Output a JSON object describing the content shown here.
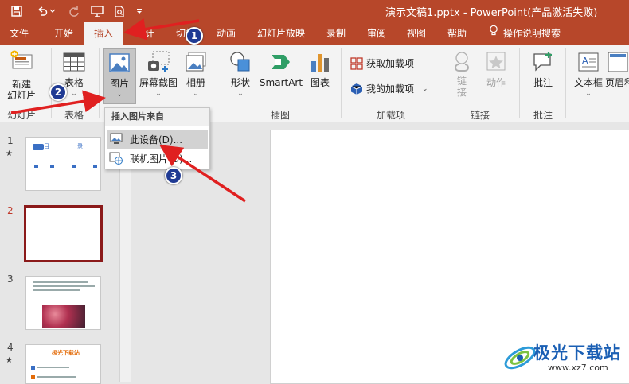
{
  "window": {
    "title": "演示文稿1.pptx  -  PowerPoint(产品激活失败)"
  },
  "tabs": [
    "文件",
    "开始",
    "插入",
    "设计",
    "切换",
    "动画",
    "幻灯片放映",
    "录制",
    "审阅",
    "视图",
    "帮助",
    "操作说明搜索"
  ],
  "active_tab": "插入",
  "ribbon": {
    "new_slide": "新建\n幻灯片",
    "table": "表格",
    "picture": "图片",
    "screenshot": "屏幕截图",
    "album": "相册",
    "shapes": "形状",
    "smartart": "SmartArt",
    "chart": "图表",
    "get_addins": "获取加载项",
    "my_addins": "我的加载项",
    "link": "链\n接",
    "action": "动作",
    "comment": "批注",
    "textbox": "文本框",
    "header_footer": "页眉和",
    "groups": {
      "slides": "幻灯片",
      "tables": "表格",
      "illustrations": "插图",
      "addins": "加载项",
      "links": "链接",
      "comments": "批注"
    }
  },
  "dropdown": {
    "header": "插入图片来自",
    "this_device": "此设备(D)...",
    "online": "联机图片(O)..."
  },
  "slides": {
    "numbers": [
      "1",
      "2",
      "3",
      "4"
    ],
    "slide1_text": [
      "目",
      "录"
    ],
    "slide4_title": "极光下载站"
  },
  "annotations": [
    "1",
    "2",
    "3"
  ],
  "watermark": {
    "name": "极光下载站",
    "url": "www.xz7.com"
  },
  "colors": {
    "accent": "#b7472a",
    "badge": "#1f3a93",
    "arrow": "#e02020"
  }
}
